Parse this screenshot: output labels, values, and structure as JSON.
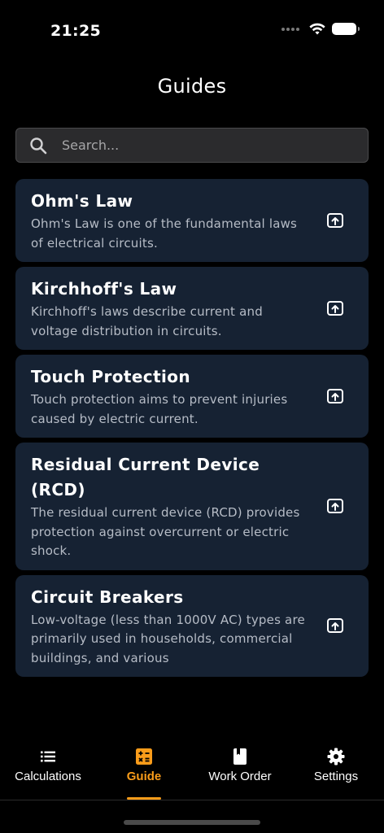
{
  "status_bar": {
    "time": "21:25"
  },
  "header": {
    "title": "Guides"
  },
  "search": {
    "placeholder": "Search..."
  },
  "guides": [
    {
      "title": "Ohm's Law",
      "description": "Ohm's Law is one of the fundamental laws of electrical circuits."
    },
    {
      "title": "Kirchhoff's Law",
      "description": "Kirchhoff's laws describe current and voltage distribution in circuits."
    },
    {
      "title": "Touch Protection",
      "description": "Touch protection aims to prevent injuries caused by electric current."
    },
    {
      "title": "Residual Current Device (RCD)",
      "description": "The residual current device (RCD) provides protection against overcurrent or electric shock."
    },
    {
      "title": "Circuit Breakers",
      "description": "Low-voltage (less than 1000V AC) types are primarily used in households, commercial buildings, and various"
    }
  ],
  "tab_bar": {
    "tabs": [
      {
        "label": "Calculations",
        "icon": "list-icon"
      },
      {
        "label": "Guide",
        "icon": "calculator-icon",
        "active": true
      },
      {
        "label": "Work Order",
        "icon": "book-icon"
      },
      {
        "label": "Settings",
        "icon": "gear-icon"
      }
    ]
  },
  "colors": {
    "accent": "#f99c1a",
    "card": "#162233",
    "background": "#000000"
  }
}
